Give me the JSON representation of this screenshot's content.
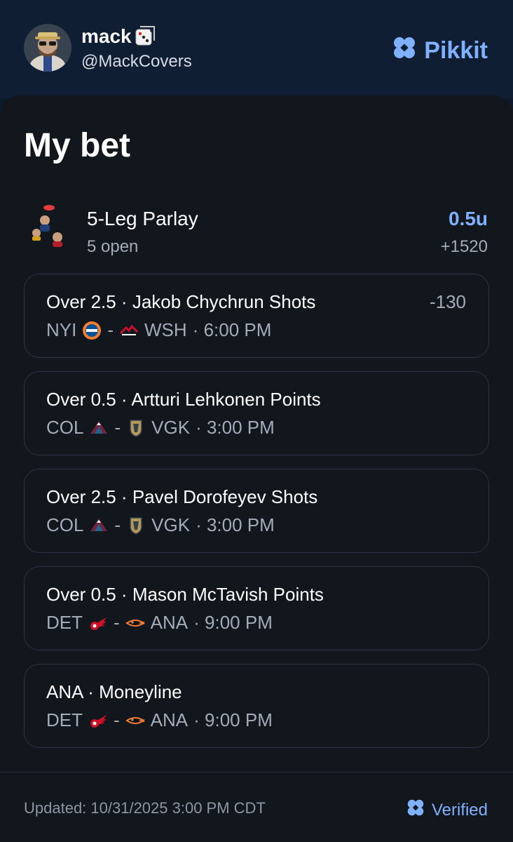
{
  "header": {
    "username": "mack",
    "handle": "@MackCovers",
    "brand": "Pikkit",
    "avatar_icon": "user-avatar",
    "dice_icon": "dice-icon",
    "brand_icon": "clover-icon",
    "brand_color": "#7fb1ff"
  },
  "bet": {
    "title": "My bet",
    "parlay": {
      "name": "5-Leg Parlay",
      "status": "5 open",
      "units": "0.5u",
      "odds": "+1520"
    },
    "legs": [
      {
        "title": "Over 2.5 · Jakob Chychrun Shots",
        "odds": "-130",
        "away": "NYI",
        "away_logo": "islanders-logo",
        "sep": "-",
        "home": "WSH",
        "home_logo": "capitals-logo",
        "time": "· 6:00 PM"
      },
      {
        "title": "Over 0.5 · Artturi Lehkonen Points",
        "odds": "",
        "away": "COL",
        "away_logo": "avalanche-logo",
        "sep": "-",
        "home": "VGK",
        "home_logo": "golden-knights-logo",
        "time": "· 3:00 PM"
      },
      {
        "title": "Over 2.5 · Pavel Dorofeyev Shots",
        "odds": "",
        "away": "COL",
        "away_logo": "avalanche-logo",
        "sep": "-",
        "home": "VGK",
        "home_logo": "golden-knights-logo",
        "time": "· 3:00 PM"
      },
      {
        "title": "Over 0.5 · Mason McTavish Points",
        "odds": "",
        "away": "DET",
        "away_logo": "red-wings-logo",
        "sep": "-",
        "home": "ANA",
        "home_logo": "ducks-logo",
        "time": "· 9:00 PM"
      },
      {
        "title": "ANA · Moneyline",
        "odds": "",
        "away": "DET",
        "away_logo": "red-wings-logo",
        "sep": "-",
        "home": "ANA",
        "home_logo": "ducks-logo",
        "time": "· 9:00 PM"
      }
    ]
  },
  "footer": {
    "updated": "Updated: 10/31/2025 3:00 PM CDT",
    "verified": "Verified",
    "verified_icon": "clover-icon"
  }
}
